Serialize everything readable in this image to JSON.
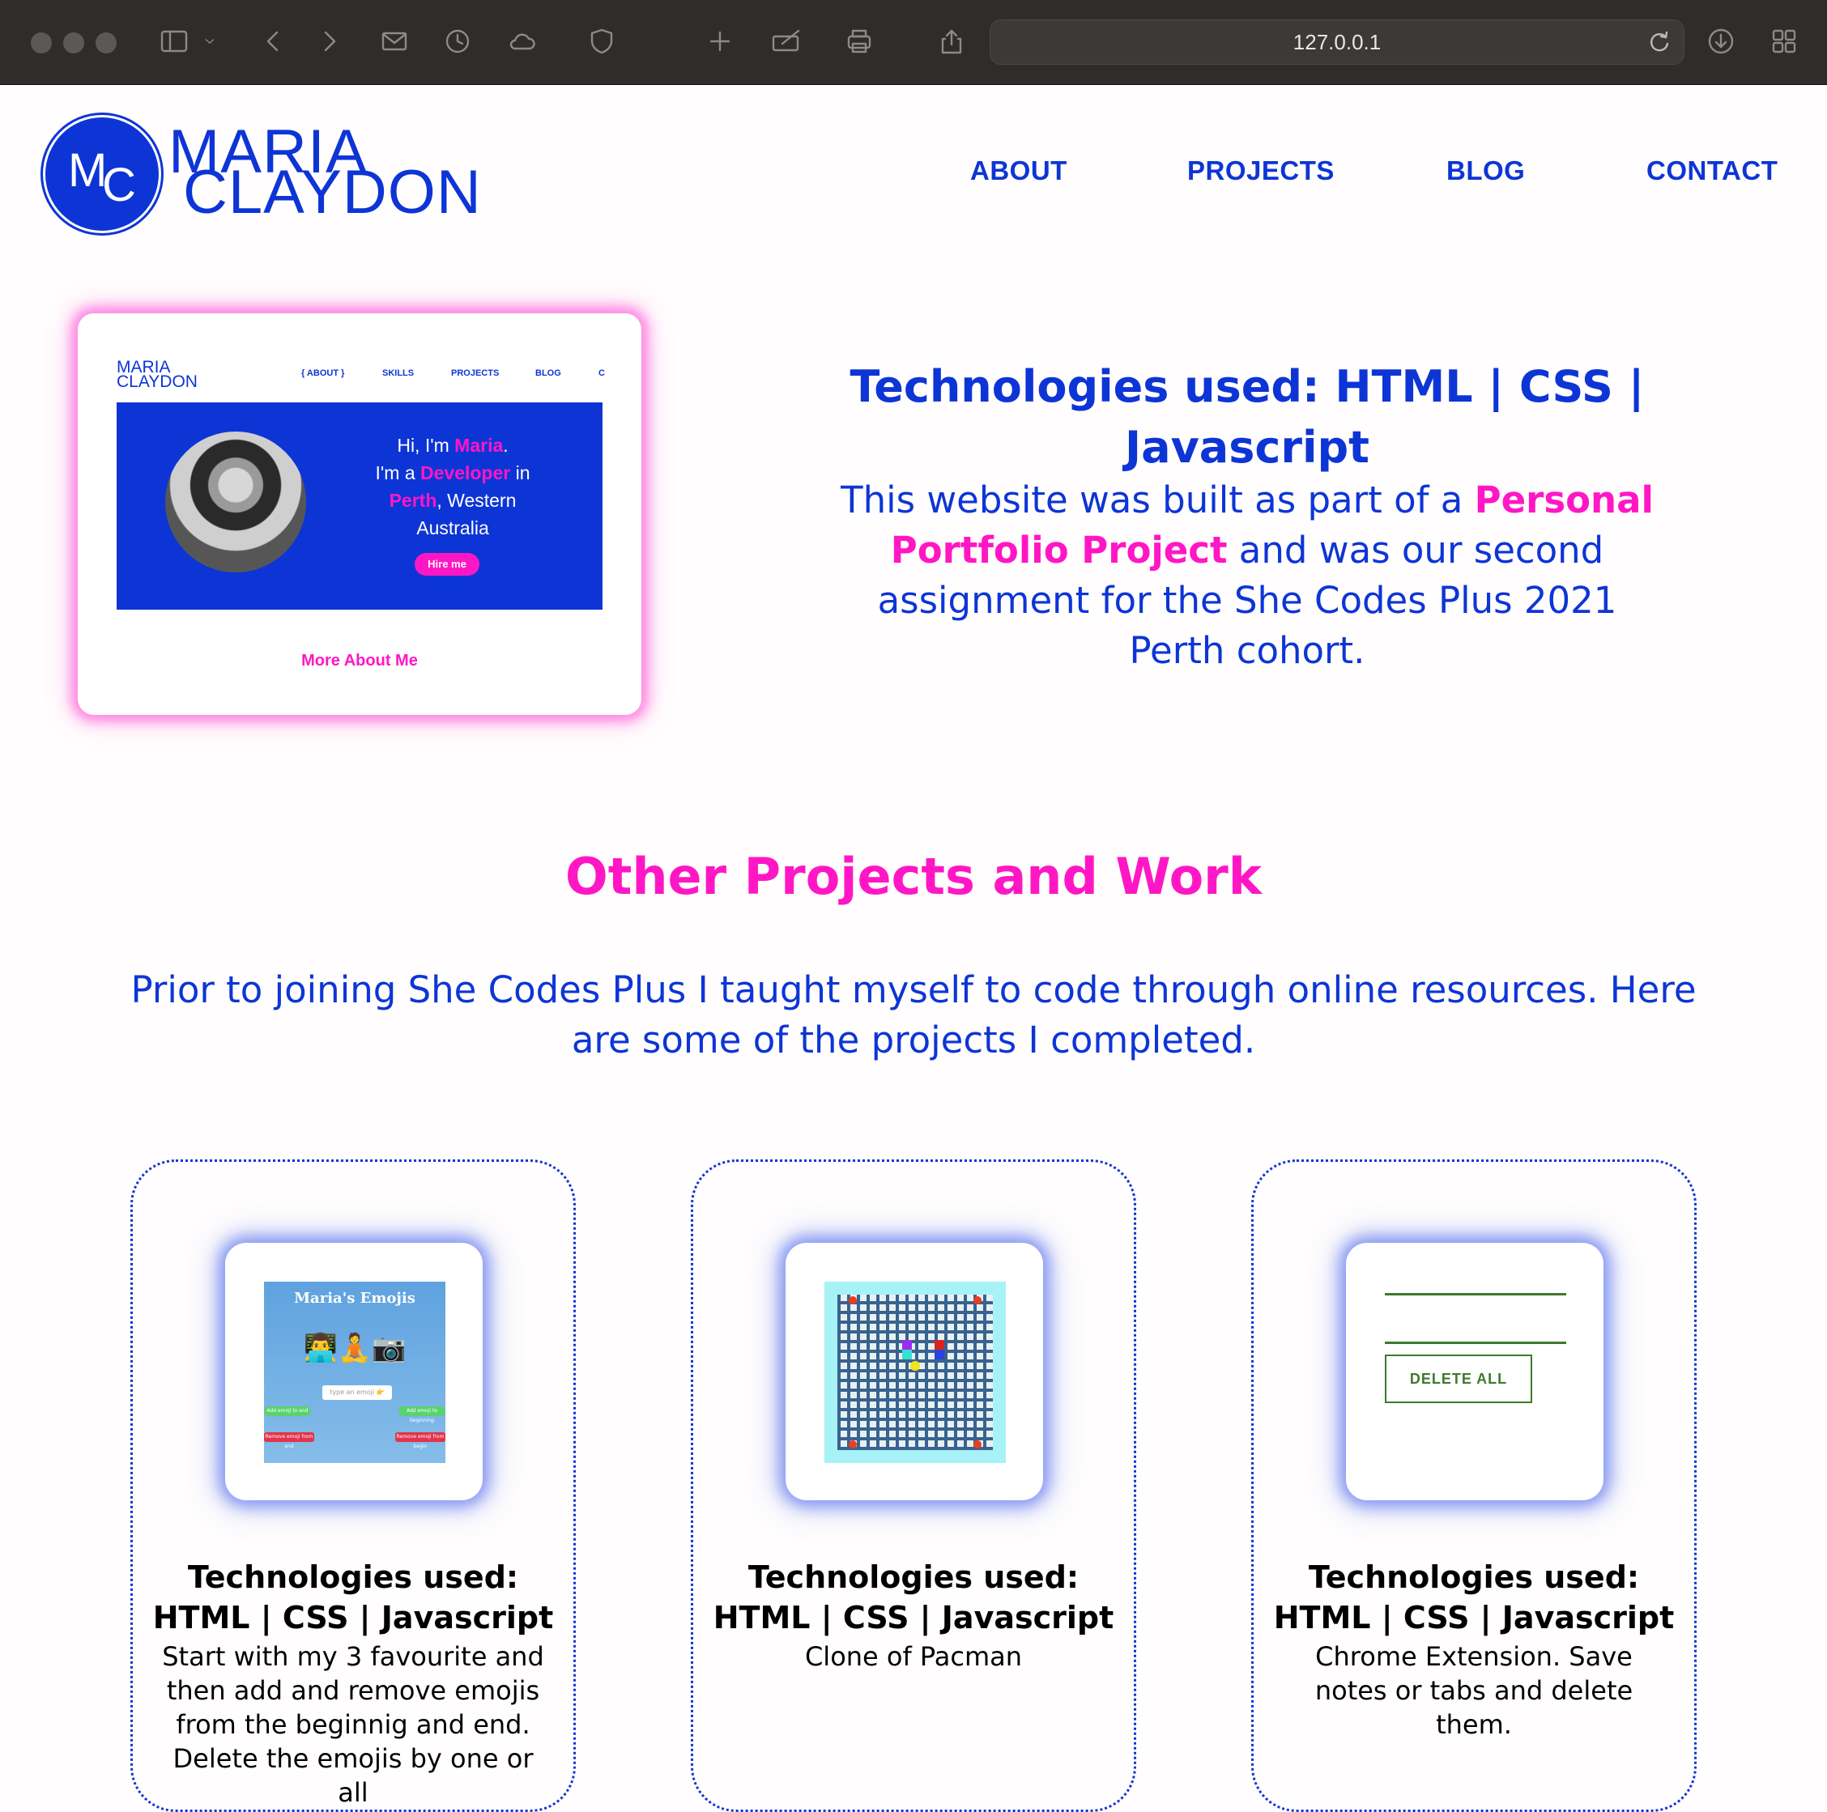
{
  "browser": {
    "url": "127.0.0.1",
    "toolbar_icons": [
      "sidebar-icon",
      "chevron-down-icon",
      "back-icon",
      "forward-icon",
      "mail-icon",
      "history-icon",
      "cloud-icon",
      "shield-icon",
      "new-tab-icon",
      "edit-icon",
      "print-icon",
      "share-icon",
      "reload-icon",
      "download-icon",
      "tab-overview-icon"
    ]
  },
  "site": {
    "logo": {
      "initial_m": "M",
      "initial_c": "C",
      "first_name": "MARIA",
      "last_name": "CLAYDON"
    },
    "nav": [
      "ABOUT",
      "PROJECTS",
      "BLOG",
      "CONTACT"
    ]
  },
  "hero": {
    "preview": {
      "name_line1": "MARIA",
      "name_line2": "CLAYDON",
      "nav": [
        "{ ABOUT }",
        "SKILLS",
        "PROJECTS",
        "BLOG",
        "C"
      ],
      "greeting_1": "Hi, I'm ",
      "greeting_name": "Maria",
      "greeting_2": ".",
      "line2_a": "I'm a ",
      "line2_role": "Developer",
      "line2_b": " in",
      "line3_city": "Perth",
      "line3_b": ", Western",
      "line4": "Australia",
      "hire_button": "Hire me",
      "more_link": "More About Me"
    },
    "tech_line1": "Technologies used: HTML | CSS |",
    "tech_line2": "Javascript",
    "desc_before": "This website was built as part of a ",
    "desc_highlight": "Personal Portfolio Project",
    "desc_after": " and was our second assignment for the She Codes Plus 2021 Perth cohort."
  },
  "other_projects": {
    "title": "Other Projects and Work",
    "intro": "Prior to joining She Codes Plus I taught myself to code through online resources. Here are some of the projects I completed.",
    "projects": [
      {
        "tech": "Technologies used: HTML | CSS | Javascript",
        "description": "Start with my 3 favourite and then add and remove emojis from the beginnig and end. Delete the emojis by one or all",
        "thumb_title": "Maria's Emojis",
        "thumb_emojis": "👨‍💻🧘📷",
        "thumb_input": "type an emoji 👉",
        "thumb_add_end": "Add emoji to end",
        "thumb_add_begin": "Add emoji to beginning",
        "thumb_remove_end": "Remove emoji from end",
        "thumb_remove_begin": "Remove emoji from begin"
      },
      {
        "tech": "Technologies used: HTML | CSS | Javascript",
        "description": "Clone of Pacman"
      },
      {
        "tech": "Technologies used: HTML | CSS | Javascript",
        "description": "Chrome Extension. Save notes or tabs and delete them.",
        "thumb_button": "DELETE ALL"
      }
    ]
  },
  "colors": {
    "brand_blue": "#0d35d6",
    "accent_pink": "#ff17c5",
    "chrome_bg": "#2e2d2b"
  }
}
